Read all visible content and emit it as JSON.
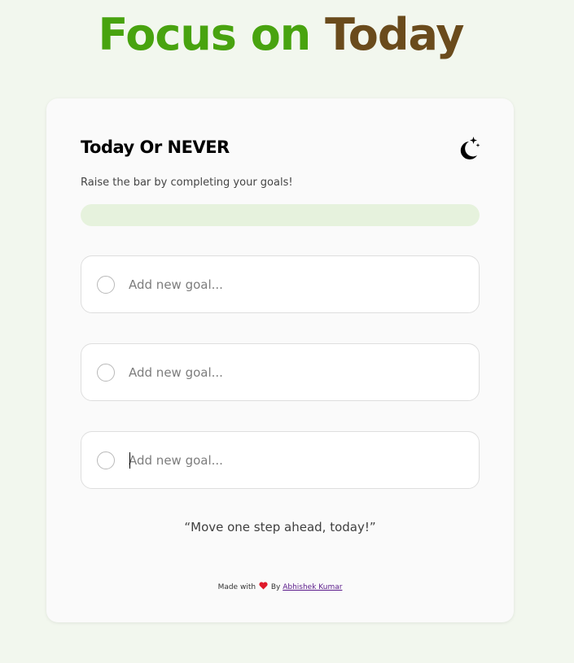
{
  "header": {
    "title_part1": "Focus on",
    "title_part2": "Today",
    "title_part1_color": "#48a30f",
    "title_part2_color": "#6a4b1c"
  },
  "card": {
    "heading": "Today Or NEVER",
    "theme_toggle_icon": "moon-stars-icon",
    "subtitle": "Raise the bar by completing your goals!",
    "progress": 0,
    "goals": [
      {
        "placeholder": "Add new goal...",
        "value": "",
        "completed": false
      },
      {
        "placeholder": "Add new goal...",
        "value": "",
        "completed": false
      },
      {
        "placeholder": "Add new goal...",
        "value": "",
        "completed": false
      }
    ],
    "quote": "“Move one step ahead, today!”"
  },
  "footer": {
    "made_with": "Made with",
    "heart_icon": "heart-icon",
    "by": "By",
    "author": "Abhishek Kumar"
  }
}
